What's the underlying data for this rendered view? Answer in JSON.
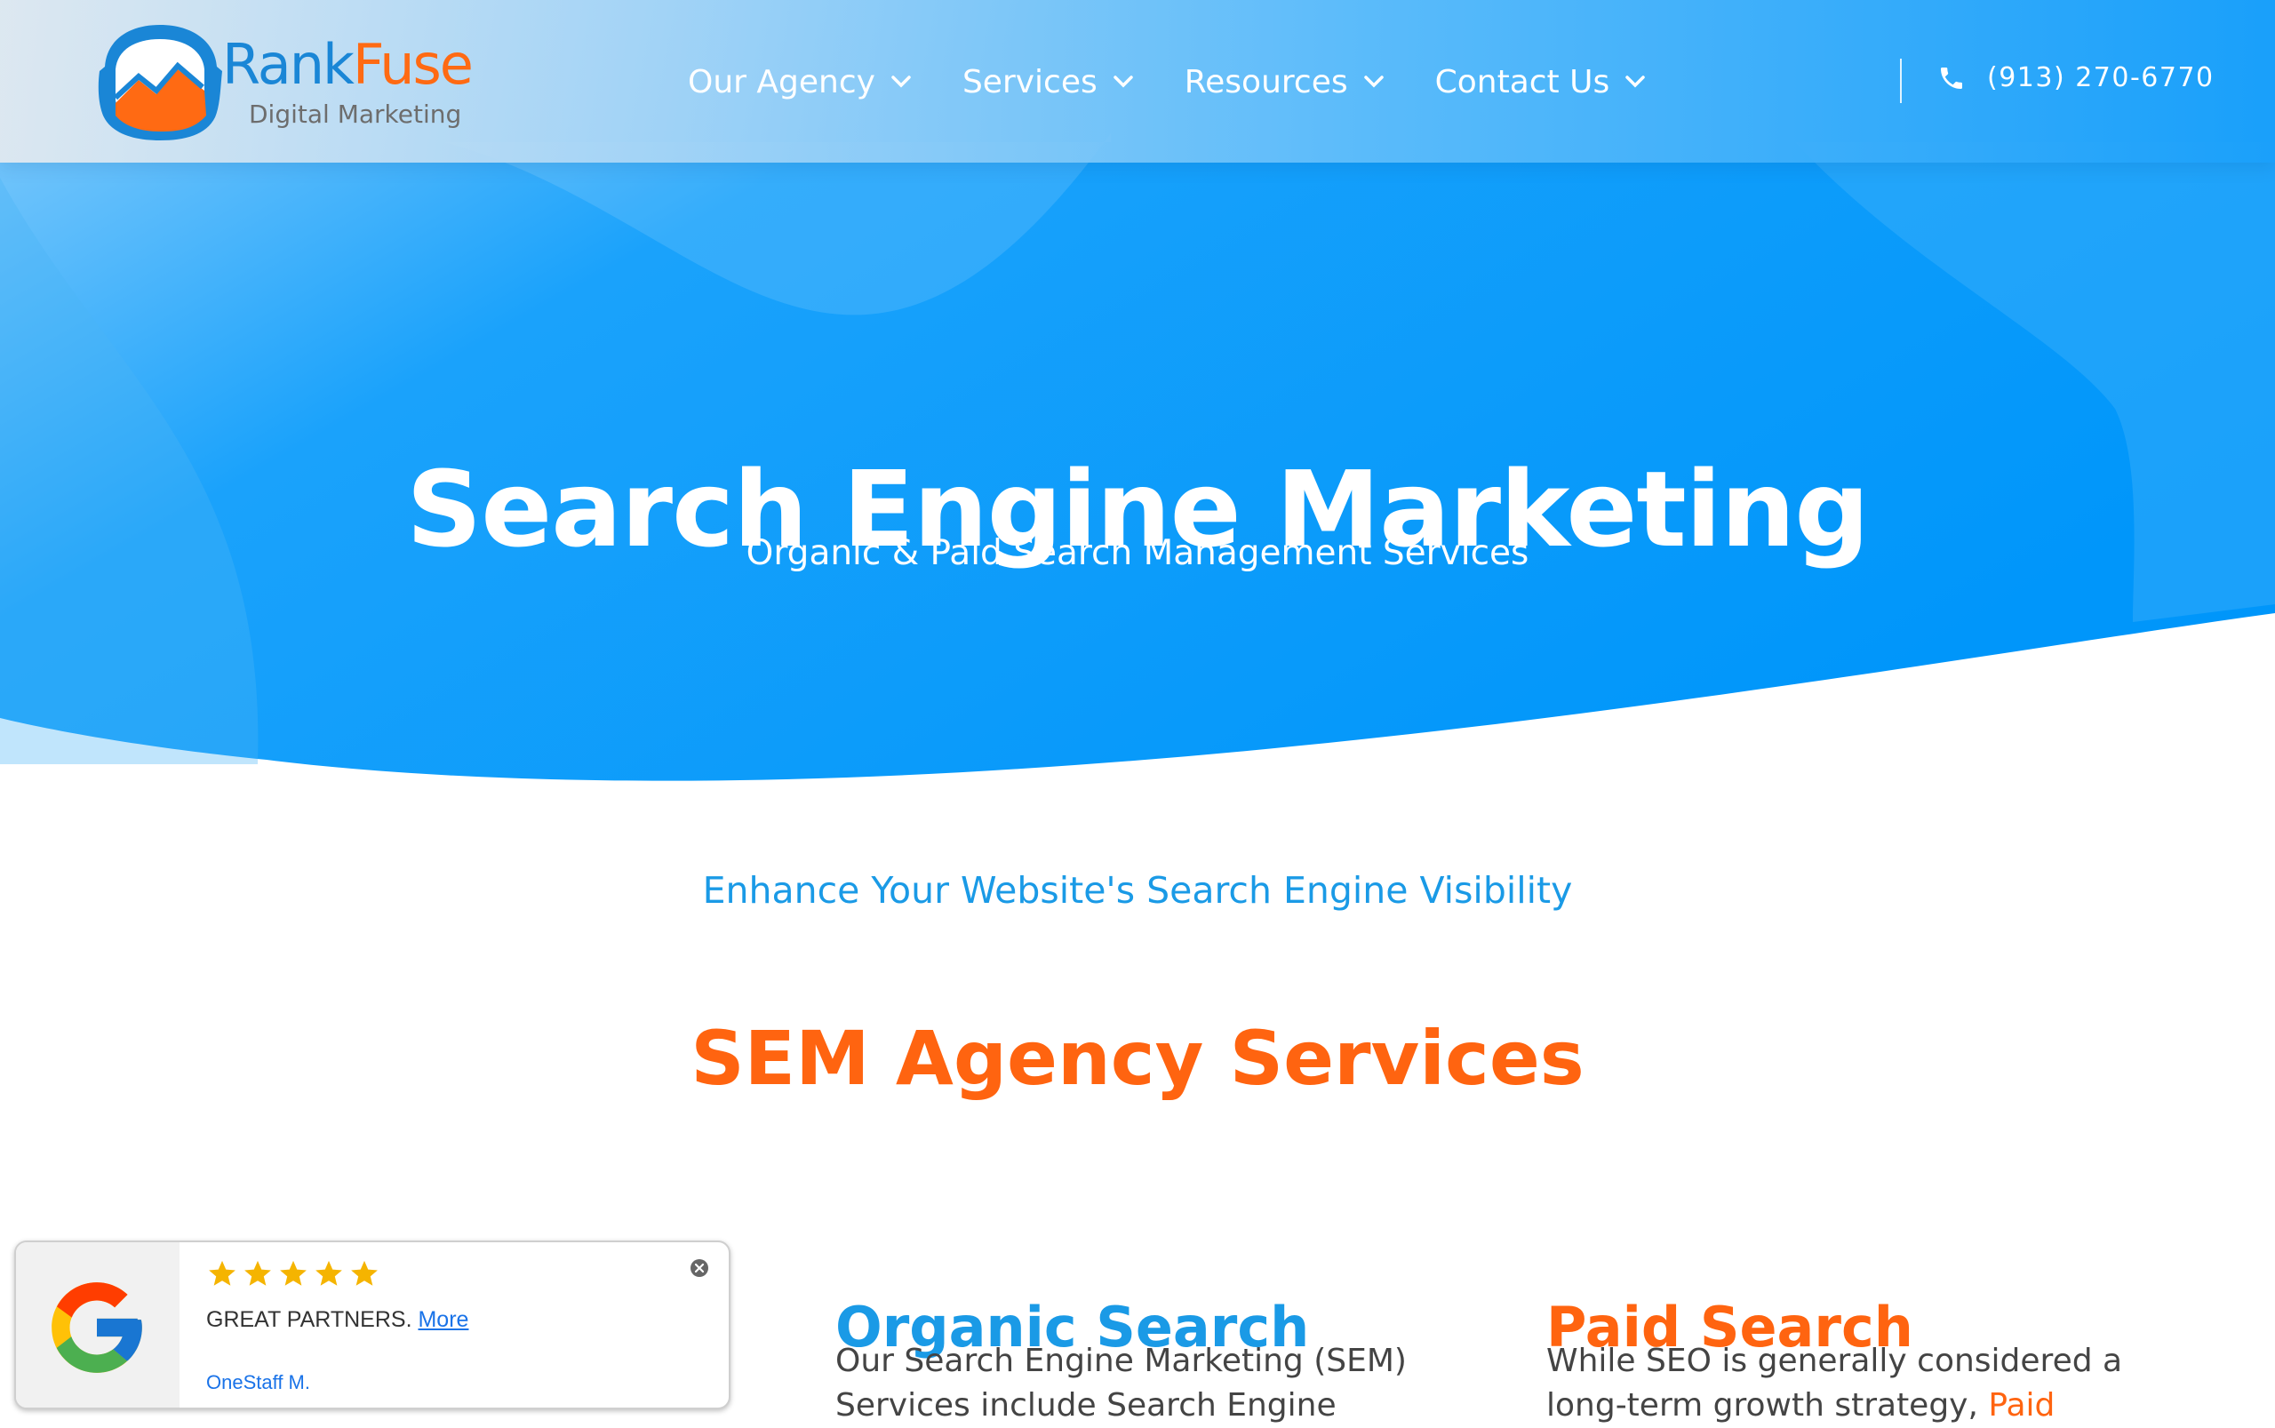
{
  "brand": {
    "name_part1": "Rank",
    "name_part2": "Fuse",
    "tagline": "Digital Marketing",
    "colors": {
      "blue": "#1a86d6",
      "orange": "#ff6a13"
    }
  },
  "nav": {
    "items": [
      {
        "label": "Our Agency",
        "icon": "chevron-down-icon"
      },
      {
        "label": "Services",
        "icon": "chevron-down-icon"
      },
      {
        "label": "Resources",
        "icon": "chevron-down-icon"
      },
      {
        "label": "Contact Us",
        "icon": "chevron-down-icon"
      }
    ],
    "phone": {
      "icon": "phone-icon",
      "number": "(913) 270-6770"
    }
  },
  "hero": {
    "title": "Search Engine Marketing",
    "subtitle": "Organic & Paid Search Management Services",
    "colors": {
      "primary": "#0a98fb",
      "light": "#7ccaf7"
    }
  },
  "section": {
    "kicker": "Enhance Your Website's Search Engine Visibility",
    "title": "SEM Agency Services",
    "columns": [
      {
        "title": "Organic Search",
        "text_line1": "Our Search Engine Marketing (SEM)",
        "text_line2": "Services include Search Engine"
      },
      {
        "title": "Paid Search",
        "text_line1": "While SEO is generally considered a",
        "text_line2_prefix": "long-term growth strategy,",
        "text_line2_link": "Paid"
      }
    ]
  },
  "review_widget": {
    "icon": "google-g-icon",
    "rating": 5,
    "text": "GREAT PARTNERS.",
    "more_label": "More",
    "author": "OneStaff M.",
    "close_icon": "close-icon"
  }
}
